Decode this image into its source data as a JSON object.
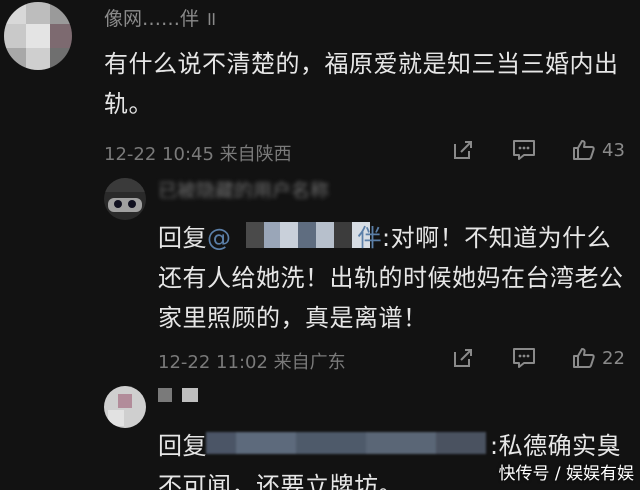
{
  "comments": {
    "main": {
      "username": "像网……伴 ॥",
      "text": "有什么说不清楚的，福原爱就是知三当三婚内出轨。",
      "date": "12-22",
      "time": "10:45",
      "location": "来自陕西",
      "like_count": "43"
    },
    "reply1": {
      "username": "已被隐藏的用户名称",
      "reply_prefix": "回复",
      "mention": "@",
      "mention_tail": "伴",
      "text_after_mention": ":对啊！不知道为什么还有人给她洗！出轨的时候她妈在台湾老公家里照顾的，真是离谱！",
      "date": "12-22",
      "time": "11:02",
      "location": "来自广东",
      "like_count": "22"
    },
    "reply2": {
      "reply_prefix": "回复",
      "text_after_mention": ":私德确实臭不可闻，还要立牌坊。"
    }
  },
  "watermark": "快传号 / 娱娱有娱",
  "icons": {
    "share": "share-icon",
    "comment": "comment-icon",
    "like": "thumbs-up-icon"
  },
  "colors": {
    "background": "#121212",
    "text": "#e6e6e6",
    "meta": "#7a7a7a",
    "mention": "#5b7fa8"
  }
}
